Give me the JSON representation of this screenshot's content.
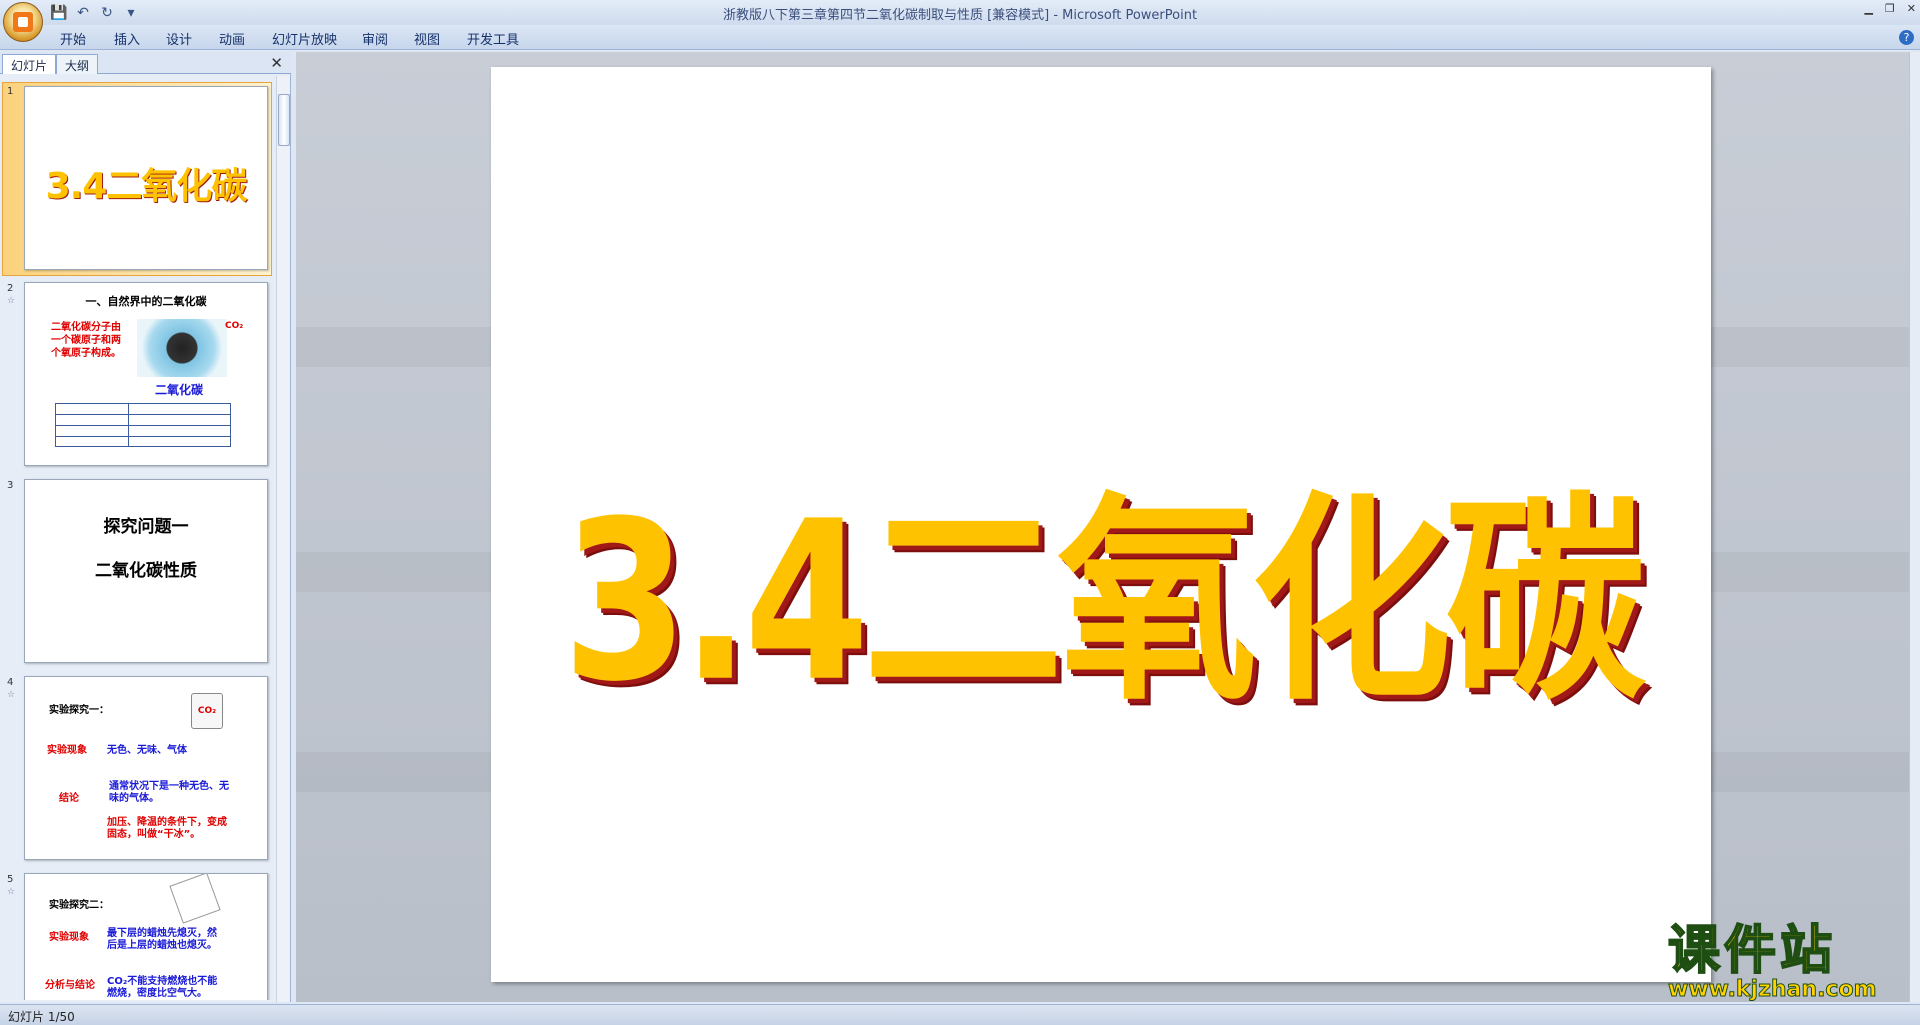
{
  "app": {
    "title": "浙教版八下第三章第四节二氧化碳制取与性质 [兼容模式] - Microsoft PowerPoint"
  },
  "ribbon": {
    "tabs": [
      "开始",
      "插入",
      "设计",
      "动画",
      "幻灯片放映",
      "审阅",
      "视图",
      "开发工具"
    ]
  },
  "pane": {
    "tab_slides": "幻灯片",
    "tab_outline": "大纲"
  },
  "thumbs": {
    "s1": {
      "num": "1",
      "title": "3.4二氧化碳"
    },
    "s2": {
      "num": "2",
      "title": "一、自然界中的二氧化碳",
      "text": "二氧化碳分子由一个碳原子和两个氧原子构成。",
      "co2": "CO₂",
      "caption": "二氧化碳"
    },
    "s3": {
      "num": "3",
      "line1": "探究问题一",
      "line2": "二氧化碳性质"
    },
    "s4": {
      "num": "4",
      "head": "实验探究一：",
      "co2": "CO₂",
      "l1": "实验现象",
      "v1": "无色、无味、气体",
      "l2": "结论",
      "v2": "通常状况下是一种无色、无味的气体。",
      "v3": "加压、降温的条件下，变成固态，叫做“干冰”。"
    },
    "s5": {
      "num": "5",
      "head": "实验探究二：",
      "l1": "实验现象",
      "v1": "最下层的蜡烛先熄灭，然后是上层的蜡烛也熄灭。",
      "l2": "分析与结论",
      "v2": "CO₂不能支持燃烧也不能燃烧，密度比空气大。"
    }
  },
  "slide": {
    "title": "3.4二氧化碳"
  },
  "status": {
    "text": "幻灯片 1/50"
  },
  "watermark": {
    "main": "课件站",
    "url": "www.kjzhan.com"
  }
}
